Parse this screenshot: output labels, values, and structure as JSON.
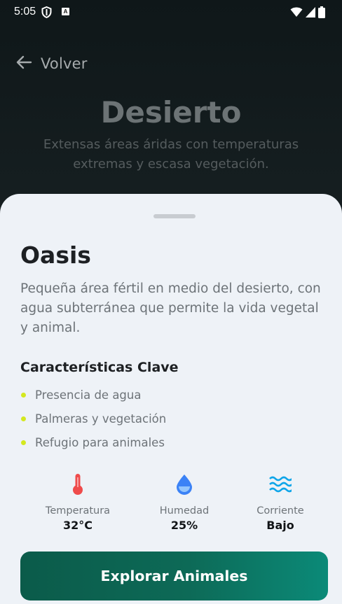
{
  "status_bar": {
    "time": "5:05",
    "icons": [
      "shield-icon",
      "a-badge-icon",
      "wifi-icon",
      "signal-icon",
      "battery-icon"
    ],
    "a_badge": "A"
  },
  "header": {
    "back_label": "Volver",
    "title": "Desierto",
    "subtitle": "Extensas áreas áridas con temperaturas extremas y escasa vegetación."
  },
  "sheet": {
    "title": "Oasis",
    "description": "Pequeña área fértil en medio del desierto, con agua subterránea que permite la vida vegetal y animal.",
    "features_title": "Características Clave",
    "features": [
      "Presencia de agua",
      "Palmeras y vegetación",
      "Refugio para animales"
    ],
    "stats": [
      {
        "icon": "thermometer-icon",
        "label": "Temperatura",
        "value": "32°C"
      },
      {
        "icon": "water-drop-icon",
        "label": "Humedad",
        "value": "25%"
      },
      {
        "icon": "waves-icon",
        "label": "Corriente",
        "value": "Bajo"
      }
    ],
    "cta_label": "Explorar Animales"
  },
  "colors": {
    "accent_bullet": "#d4e81f",
    "thermometer": "#ef4b4b",
    "water": "#3b82f6",
    "waves": "#0ea5e9",
    "cta_start": "#0b5b4a",
    "cta_end": "#0b8a78",
    "sheet_bg": "#eef2f7"
  }
}
